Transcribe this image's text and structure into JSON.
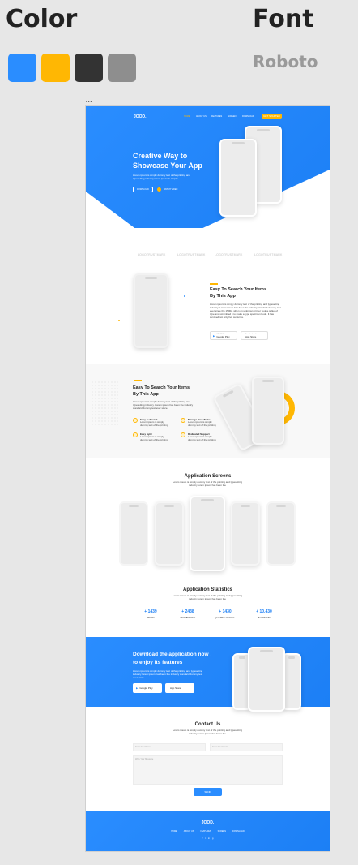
{
  "styleguide": {
    "color_heading": "Color",
    "font_heading": "Font",
    "font_name": "Roboto",
    "colors": [
      "#2a8dff",
      "#ffb703",
      "#333333",
      "#8e8e8e"
    ]
  },
  "page": {
    "header": {
      "logo": "JOOD.",
      "nav": [
        "HOME",
        "ABOUT US",
        "FEATURES",
        "SCREEN",
        "DOWNLOAD"
      ],
      "cta": "GET STARTED"
    },
    "hero": {
      "title_line1": "Creative Way to",
      "title_line2": "Showcase Your App",
      "subtitle": "Lorem ipsum is simply dummy text of the printing and typesetting industry lorem ipsum is simply",
      "primary_button": "DOWNLOAD",
      "secondary_button": "WATCH VIDEO"
    },
    "logos": [
      "LOGOTRUSTMARK",
      "LOGOTRUSTMARK",
      "LOGOTRUSTMARK",
      "LOGOTRUSTMARK"
    ],
    "feature1": {
      "title_line1": "Easy To Search Your Items",
      "title_line2": "By This App",
      "body": "Lorem ipsum is simply dummy text of the printing and typesetting industry. Lorem ipsum has been the industry standard dummy text ever since the 1500s, when an unknown printer took a galley of type and scrambled it to make a type specimen book. It has survived not only five centuries.",
      "google_play": "Google Play",
      "app_store": "App Store",
      "store_small_1": "GET IT ON",
      "store_small_2": "Download on the"
    },
    "feature2": {
      "title_line1": "Easy To Search Your Items",
      "title_line2": "By This App",
      "body": "Lorem ipsum is simply dummy text of the printing and typesetting industry. Lorem ipsum has been the industry standard dummy text ever since.",
      "items": [
        {
          "title": "Easy to Search",
          "text": "Lorem ipsum is simply dummy text of the printing"
        },
        {
          "title": "Manage Your Tasks",
          "text": "Lorem ipsum is simply dummy text of the printing"
        },
        {
          "title": "Easy Sync",
          "text": "Lorem ipsum is simply dummy text of the printing"
        },
        {
          "title": "Dedicated Support",
          "text": "Lorem ipsum is simply dummy text of the printing"
        }
      ]
    },
    "screens": {
      "title": "Application Screens",
      "subtitle": "Lorem ipsum is simply dummy text of the printing and typesetting industry lorem ipsum has been the"
    },
    "stats": {
      "title": "Application Statistics",
      "subtitle": "Lorem ipsum is simply dummy text of the printing and typesetting industry lorem ipsum has been the",
      "items": [
        {
          "value": "+ 1439",
          "label": "Clients"
        },
        {
          "value": "+ 2438",
          "label": "Beneficiaries"
        },
        {
          "value": "+ 1430",
          "label": "positive reviews"
        },
        {
          "value": "+ 10.430",
          "label": "Downloads"
        }
      ]
    },
    "download": {
      "title_line1": "Download the application now !",
      "title_line2": "to enjoy its features",
      "body": "Lorem ipsum is simply dummy text of the printing and typesetting industry lorem ipsum has been the industry standard dummy text ever since",
      "google_play": "Google Play",
      "app_store": "App Store"
    },
    "contact": {
      "title": "Contact Us",
      "subtitle": "Lorem ipsum is simply dummy text of the printing and typesetting industry lorem ipsum has been the",
      "name_placeholder": "Enter Your Name",
      "email_placeholder": "Enter Your Email",
      "message_placeholder": "Write Your Message",
      "submit": "SEND"
    },
    "footer": {
      "logo": "JOOD.",
      "nav": [
        "HOME",
        "ABOUT US",
        "FEATURES",
        "SCREEN",
        "DOWNLOAD"
      ],
      "social": [
        "f",
        "t",
        "in",
        "g"
      ]
    }
  }
}
